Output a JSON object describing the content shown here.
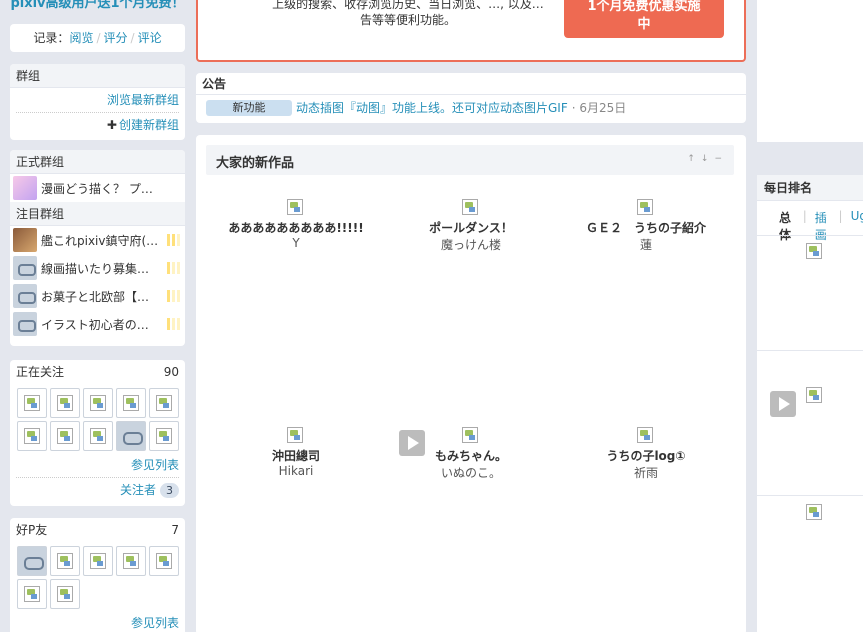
{
  "left": {
    "premium_link": "pixiv高级用户送1个月免费！",
    "records": {
      "label": "记录：",
      "items": [
        "阅览",
        "评分",
        "评论"
      ]
    },
    "groups": {
      "title": "群组",
      "browse": "浏览最新群组",
      "create": "创建新群组",
      "plus_icon": "plus-icon"
    },
    "official_groups": {
      "title": "正式群组",
      "items": [
        {
          "name": "漫画どう描く？ プ…"
        }
      ]
    },
    "watched_groups": {
      "title": "注目群组",
      "items": [
        {
          "name": "艦これpixiv鎮守府(…"
        },
        {
          "name": "線画描いたり募集…"
        },
        {
          "name": "お菓子と北欧部【…"
        },
        {
          "name": "イラスト初心者の…"
        }
      ]
    },
    "following": {
      "title": "正在关注",
      "count": "90",
      "see_list": "参见列表",
      "followers_label": "关注者",
      "followers_count": "3"
    },
    "mypixiv": {
      "title": "好P友",
      "count": "7",
      "see_list": "参见列表"
    }
  },
  "center": {
    "promo": {
      "text_line1": "上级的搜索、收存浏览历史、当日浏览、…, 以及…",
      "text_line2": "告等等便利功能。",
      "button_line1": "1个月免费优惠实施",
      "button_line2": "中"
    },
    "notice": {
      "title": "公告",
      "tag": "新功能",
      "text": "动态插图『动图』功能上线。还可对应动态图片GIF",
      "date": "· 6月25日"
    },
    "works": {
      "title": "大家的新作品",
      "controls": [
        "↑",
        "↓",
        "−"
      ],
      "items": [
        {
          "title": "あああああああああ!!!!!",
          "author": "Y"
        },
        {
          "title": "ポールダンス！",
          "author": "魔っけん楼"
        },
        {
          "title": "ＧＥ２　うちの子紹介",
          "author": "蓮"
        },
        {
          "title": "沖田總司",
          "author": "Hikari"
        },
        {
          "title": "もみちゃん。",
          "author": "いぬのこ。"
        },
        {
          "title": "うちの子log①",
          "author": "祈雨"
        }
      ]
    }
  },
  "right": {
    "ranking": {
      "title": "每日排名",
      "tabs": [
        "总体",
        "插画",
        "Ug"
      ]
    }
  }
}
